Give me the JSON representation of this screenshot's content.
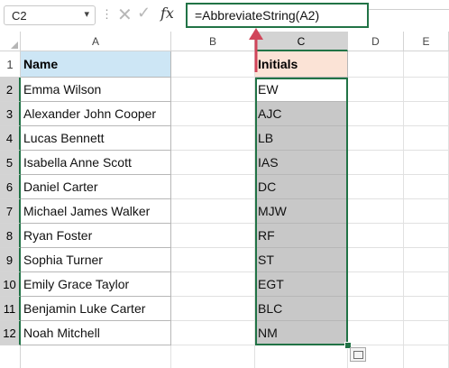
{
  "formula_bar": {
    "name_box": "C2",
    "formula": "=AbbreviateString(A2)"
  },
  "columns": [
    "A",
    "B",
    "C",
    "D",
    "E"
  ],
  "rows": [
    "1",
    "2",
    "3",
    "4",
    "5",
    "6",
    "7",
    "8",
    "9",
    "10",
    "11",
    "12"
  ],
  "table": {
    "header_name": "Name",
    "header_initials": "Initials",
    "records": [
      {
        "name": "Emma Wilson",
        "initials": "EW"
      },
      {
        "name": "Alexander John Cooper",
        "initials": "AJC"
      },
      {
        "name": "Lucas Bennett",
        "initials": "LB"
      },
      {
        "name": "Isabella Anne Scott",
        "initials": "IAS"
      },
      {
        "name": "Daniel Carter",
        "initials": "DC"
      },
      {
        "name": "Michael James Walker",
        "initials": "MJW"
      },
      {
        "name": "Ryan Foster",
        "initials": "RF"
      },
      {
        "name": "Sophia Turner",
        "initials": "ST"
      },
      {
        "name": "Emily Grace Taylor",
        "initials": "EGT"
      },
      {
        "name": "Benjamin Luke Carter",
        "initials": "BLC"
      },
      {
        "name": "Noah Mitchell",
        "initials": "NM"
      }
    ]
  },
  "colors": {
    "accent_green": "#217346",
    "header_blue": "#cde6f5",
    "header_peach": "#fbe3d6",
    "arrow_red": "#d1455a"
  },
  "icons": [
    "chevron-down-icon",
    "cancel-x-icon",
    "enter-check-icon",
    "function-fx-icon",
    "quick-analysis-icon",
    "annotation-arrow-icon"
  ]
}
